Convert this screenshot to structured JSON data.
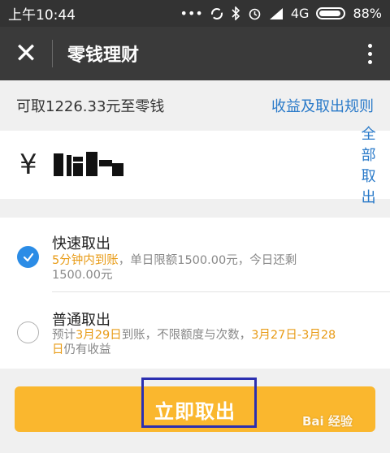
{
  "status_bar": {
    "time": "上午10:44",
    "network": "4G",
    "battery": "88%",
    "icons": [
      "dots-icon",
      "sync-icon",
      "bluetooth-icon",
      "alarm-icon",
      "signal-icon",
      "battery-icon"
    ]
  },
  "app_bar": {
    "close_glyph": "✕",
    "title": "零钱理财"
  },
  "info": {
    "available": "可取1226.33元至零钱",
    "rules_link": "收益及取出规则"
  },
  "amount": {
    "currency": "¥",
    "value": "",
    "all_out": "全部取出"
  },
  "options": {
    "fast": {
      "title": "快速取出",
      "hl1": "5分钟内到账",
      "desc1": "，单日限额1500.00元，今日还剩",
      "desc2": "1500.00元",
      "selected": true
    },
    "normal": {
      "title": "普通取出",
      "pre": "预计",
      "hl_date": "3月29日",
      "mid": "到账，不限额度与次数，",
      "hl_range": "3月27日-3月28",
      "hl_range2": "日",
      "post": "仍有收益",
      "selected": false
    }
  },
  "submit": {
    "label": "立即取出"
  },
  "watermark": {
    "text": "Bai 经验"
  },
  "colors": {
    "accent_blue": "#2a7ac9",
    "highlight_orange": "#e89b16",
    "button_yellow": "#fab72e"
  }
}
